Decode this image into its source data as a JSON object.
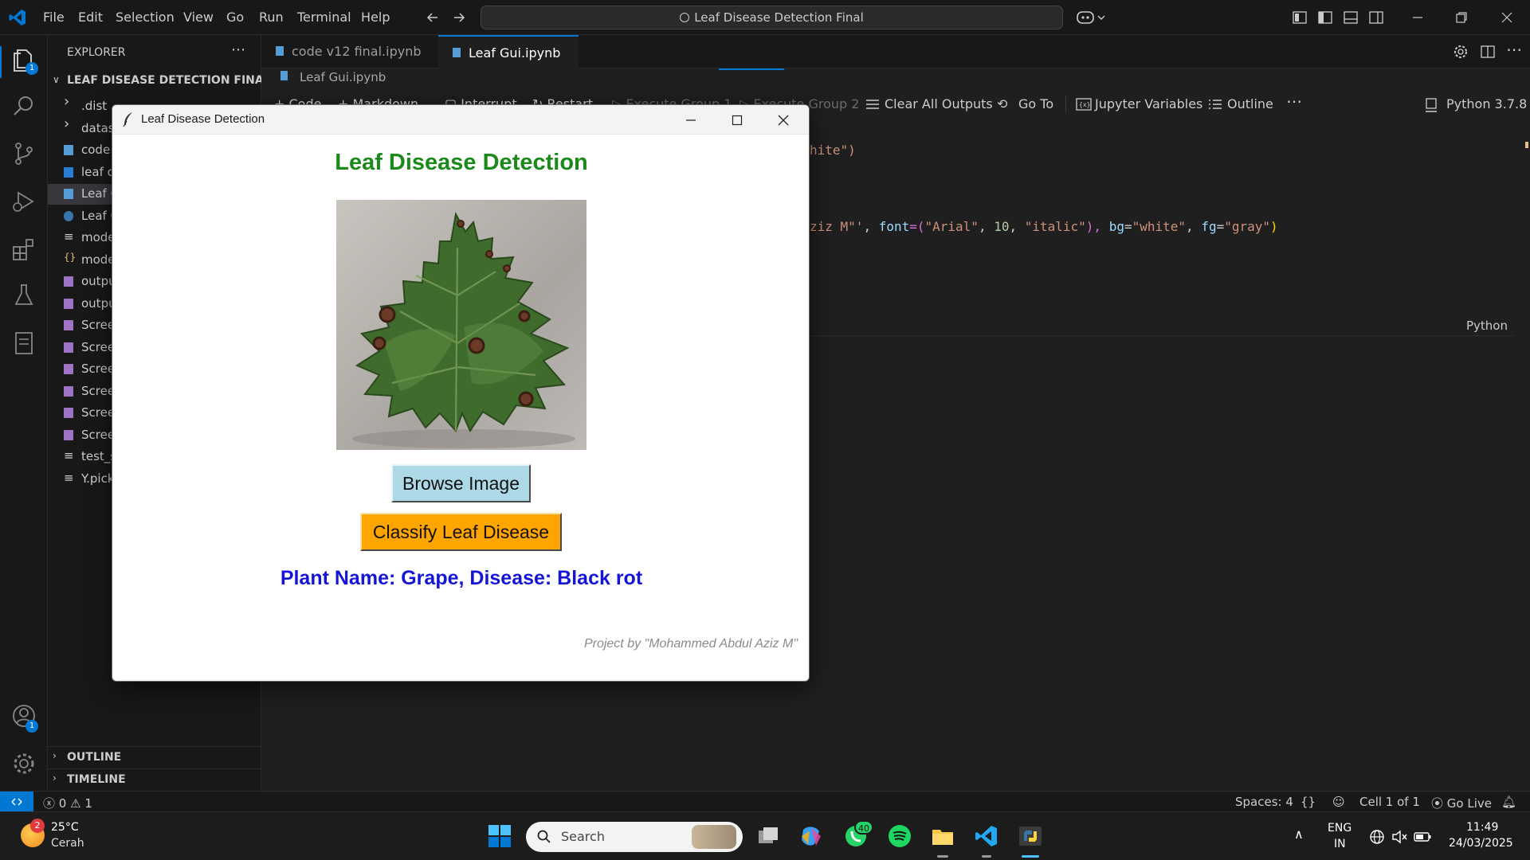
{
  "titlebar": {
    "menus": [
      "File",
      "Edit",
      "Selection",
      "View",
      "Go",
      "Run",
      "Terminal",
      "Help"
    ],
    "search_text": "Leaf Disease Detection Final"
  },
  "activity": {
    "explorer_badge": "1",
    "accounts_badge": "1"
  },
  "sidebar": {
    "header": "EXPLORER",
    "folder": "LEAF DISEASE DETECTION FINAL",
    "items": [
      {
        "label": ".dist",
        "icon": "chevron-right-icon"
      },
      {
        "label": "datas",
        "icon": "chevron-right-icon"
      },
      {
        "label": "code",
        "icon": "notebook-icon"
      },
      {
        "label": "leaf c",
        "icon": "word-doc-icon"
      },
      {
        "label": "Leaf G",
        "icon": "notebook-icon"
      },
      {
        "label": "Leaf G",
        "icon": "python-icon"
      },
      {
        "label": "mode",
        "icon": "text-file-icon"
      },
      {
        "label": "mode",
        "icon": "json-icon"
      },
      {
        "label": "outpu",
        "icon": "image-file-icon"
      },
      {
        "label": "outpu",
        "icon": "image-file-icon"
      },
      {
        "label": "Scree",
        "icon": "image-file-icon"
      },
      {
        "label": "Scree",
        "icon": "image-file-icon"
      },
      {
        "label": "Scree",
        "icon": "image-file-icon"
      },
      {
        "label": "Scree",
        "icon": "image-file-icon"
      },
      {
        "label": "Scree",
        "icon": "image-file-icon"
      },
      {
        "label": "Scree",
        "icon": "image-file-icon"
      },
      {
        "label": "test_s",
        "icon": "text-file-icon"
      },
      {
        "label": "Y.pick",
        "icon": "text-file-icon"
      }
    ],
    "outline": "OUTLINE",
    "timeline": "TIMELINE"
  },
  "editor": {
    "tabs": [
      {
        "label": "code v12 final.ipynb",
        "active": false
      },
      {
        "label": "Leaf Gui.ipynb",
        "active": true
      }
    ],
    "breadcrumb": "Leaf Gui.ipynb",
    "toolbar": {
      "code": "Code",
      "markdown": "Markdown",
      "interrupt": "Interrupt",
      "restart": "Restart",
      "execute_group1": "Execute Group 1",
      "execute_group2": "Execute Group 2",
      "clear_outputs": "Clear All Outputs",
      "goto": "Go To",
      "variables": "Jupyter Variables",
      "outline": "Outline",
      "kernel": "Python 3.7.8"
    },
    "code_line1": "hite\")",
    "code_line2_parts": [
      "ziz M\"'",
      ", ",
      "font",
      "=(",
      "\"Arial\"",
      ", ",
      "10",
      ", ",
      "\"italic\"",
      "), ",
      "bg",
      "=",
      "\"white\"",
      ", ",
      "fg",
      "=",
      "\"gray\"",
      ")"
    ],
    "cell_language": "Python"
  },
  "statusbar": {
    "errors": "0",
    "warnings": "1",
    "spaces": "Spaces: 4",
    "braces": "{}",
    "cell": "Cell 1 of 1",
    "golive": "Go Live"
  },
  "taskbar": {
    "weather_temp": "25°C",
    "weather_desc": "Cerah",
    "weather_badge": "2",
    "search_label": "Search",
    "whatsapp_badge": "40",
    "lang_line1": "ENG",
    "lang_line2": "IN",
    "time": "11:49",
    "date": "24/03/2025"
  },
  "tk_window": {
    "title": "Leaf Disease Detection",
    "heading": "Leaf Disease Detection",
    "browse_label": "Browse Image",
    "classify_label": "Classify Leaf Disease",
    "result": "Plant Name: Grape, Disease: Black rot",
    "credit": "Project by \"Mohammed Abdul Aziz M\""
  },
  "colors": {
    "heading_green": "#1b8a1b",
    "browse_bg": "#add8e6",
    "classify_bg": "#ffa500",
    "result_blue": "#1515d6",
    "vscode_accent": "#0078d4"
  }
}
